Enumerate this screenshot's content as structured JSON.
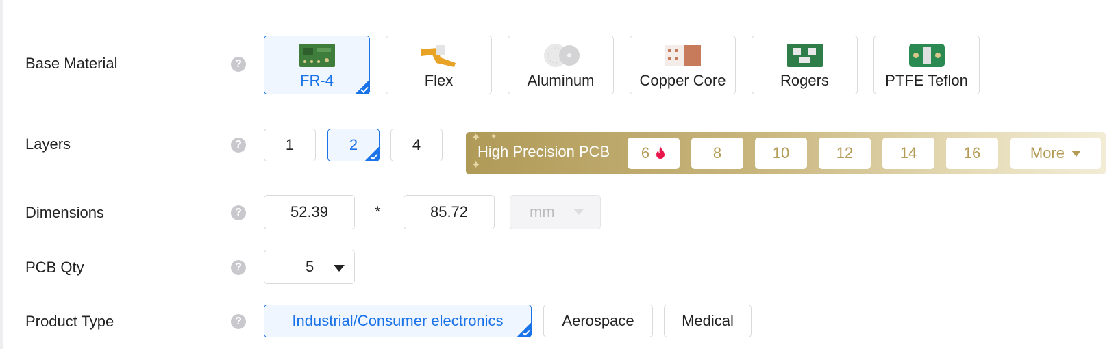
{
  "colors": {
    "accent": "#1a73e8",
    "gold": "#b39a55",
    "hot": "#e8174b"
  },
  "icons": {
    "help": "question-circle-icon",
    "check": "checkmark-icon",
    "hot": "flame-icon",
    "caret": "caret-down-icon"
  },
  "help_glyph": "?",
  "base_material": {
    "label": "Base Material",
    "options": [
      {
        "label": "FR-4",
        "selected": true
      },
      {
        "label": "Flex",
        "selected": false
      },
      {
        "label": "Aluminum",
        "selected": false
      },
      {
        "label": "Copper Core",
        "selected": false
      },
      {
        "label": "Rogers",
        "selected": false
      },
      {
        "label": "PTFE Teflon",
        "selected": false
      }
    ]
  },
  "layers": {
    "label": "Layers",
    "options": [
      {
        "label": "1",
        "selected": false
      },
      {
        "label": "2",
        "selected": true
      },
      {
        "label": "4",
        "selected": false
      }
    ],
    "high_precision": {
      "title": "High Precision PCB",
      "options": [
        "6",
        "8",
        "10",
        "12",
        "14",
        "16"
      ],
      "more_label": "More"
    }
  },
  "dimensions": {
    "label": "Dimensions",
    "width": "52.39",
    "separator": "*",
    "height": "85.72",
    "unit": "mm"
  },
  "pcb_qty": {
    "label": "PCB Qty",
    "value": "5"
  },
  "product_type": {
    "label": "Product Type",
    "options": [
      {
        "label": "Industrial/Consumer electronics",
        "selected": true
      },
      {
        "label": "Aerospace",
        "selected": false
      },
      {
        "label": "Medical",
        "selected": false
      }
    ]
  }
}
